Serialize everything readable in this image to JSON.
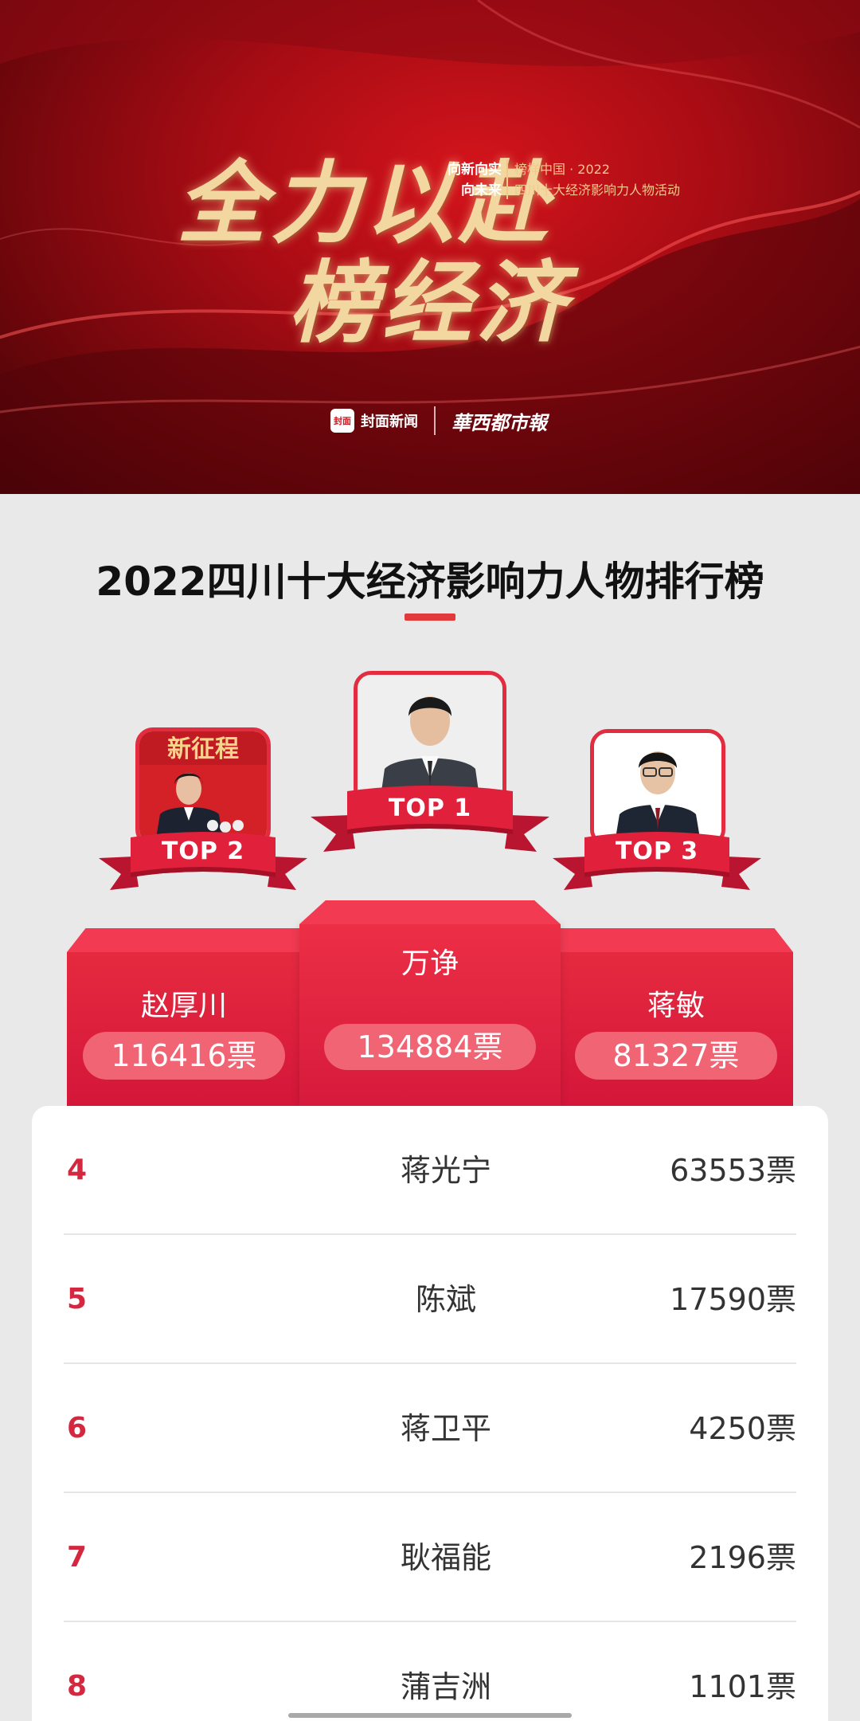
{
  "banner": {
    "calligraphy_line1": "全力以赴",
    "calligraphy_line2": "榜经济",
    "slogan_line1": "向新向实",
    "slogan_line2": "向未来",
    "event_line1": "榜样中国 · 2022",
    "event_line2": "四川十大经济影响力人物活动",
    "logo1_badge": "封面",
    "logo1_text": "封面新闻",
    "logo2_text": "華西都市報"
  },
  "title": "2022四川十大经济影响力人物排行榜",
  "top3": {
    "first": {
      "badge": "TOP 1",
      "name": "万诤",
      "votes": "134884票"
    },
    "second": {
      "badge": "TOP 2",
      "name": "赵厚川",
      "votes": "116416票"
    },
    "third": {
      "badge": "TOP 3",
      "name": "蒋敏",
      "votes": "81327票"
    }
  },
  "ranking": [
    {
      "rank": "4",
      "name": "蒋光宁",
      "votes": "63553票"
    },
    {
      "rank": "5",
      "name": "陈斌",
      "votes": "17590票"
    },
    {
      "rank": "6",
      "name": "蒋卫平",
      "votes": "4250票"
    },
    {
      "rank": "7",
      "name": "耿福能",
      "votes": "2196票"
    },
    {
      "rank": "8",
      "name": "蒲吉洲",
      "votes": "1101票"
    }
  ],
  "colors": {
    "accent": "#d3283f",
    "podium": "#e52a3f",
    "banner": "#a80c14"
  }
}
